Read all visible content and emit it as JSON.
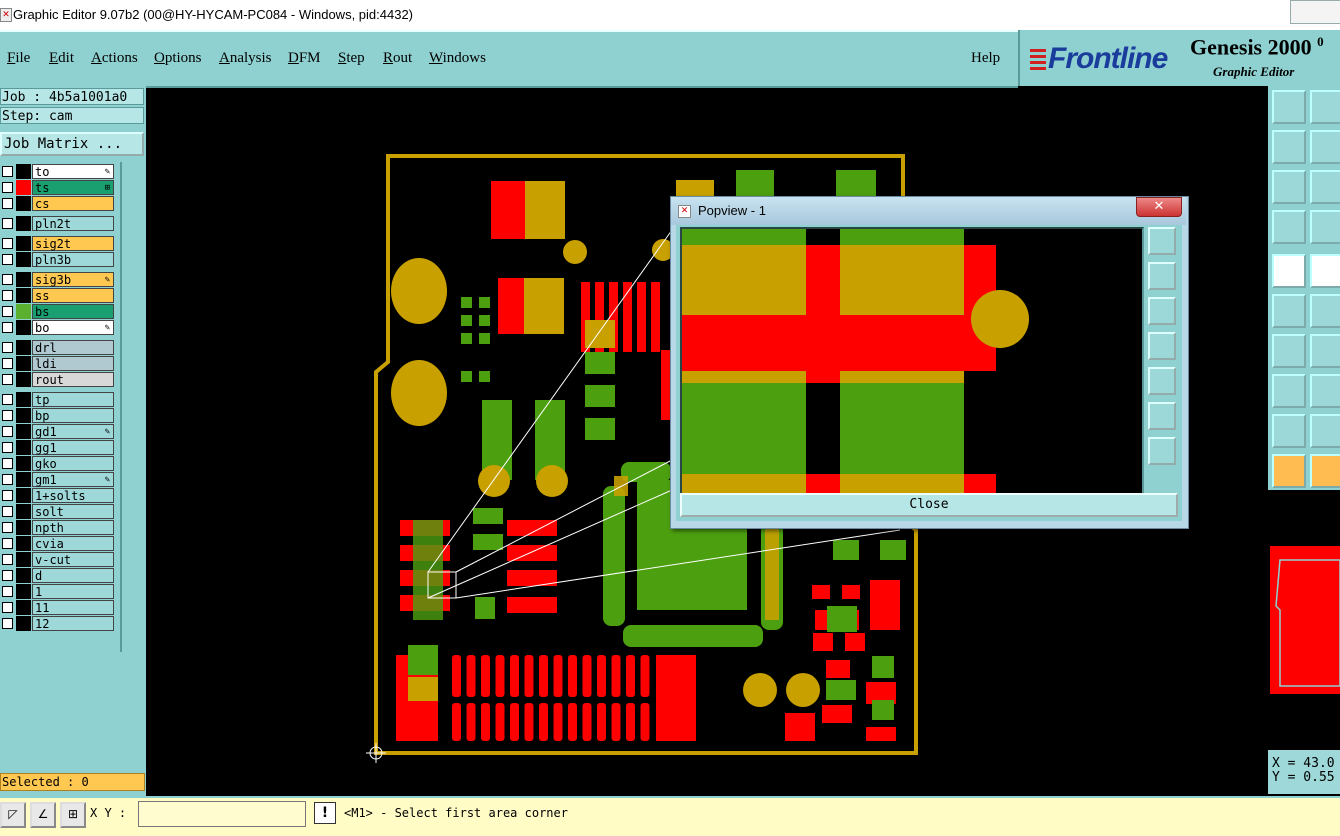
{
  "window": {
    "title": "Graphic Editor 9.07b2 (00@HY-HYCAM-PC084 - Windows, pid:4432)"
  },
  "menu": {
    "file": "File",
    "edit": "Edit",
    "actions": "Actions",
    "options": "Options",
    "analysis": "Analysis",
    "dfm": "DFM",
    "step": "Step",
    "rout": "Rout",
    "windows": "Windows",
    "help": "Help"
  },
  "brand": {
    "logo": "Frontline",
    "product": "Genesis 2000",
    "version_frag": "0",
    "subtitle": "Graphic Editor"
  },
  "job": {
    "job_line": "Job : 4b5a1001a0",
    "step_line": "Step: cam",
    "matrix_button": "Job Matrix ..."
  },
  "layers": [
    {
      "name": "to",
      "bg": "#ffffff",
      "swatch": "#000000",
      "mark": "brush"
    },
    {
      "name": "ts",
      "bg": "#1aa070",
      "swatch": "#ff0000",
      "mark": "grid"
    },
    {
      "name": "cs",
      "bg": "#ffc850",
      "swatch": "#000000",
      "mark": ""
    },
    {
      "name": "pln2t",
      "bg": "#9ed8d8",
      "swatch": "#000000",
      "mark": ""
    },
    {
      "name": "sig2t",
      "bg": "#ffc850",
      "swatch": "#000000",
      "mark": ""
    },
    {
      "name": "pln3b",
      "bg": "#9ed8d8",
      "swatch": "#000000",
      "mark": ""
    },
    {
      "name": "sig3b",
      "bg": "#ffc850",
      "swatch": "#000000",
      "mark": "brush"
    },
    {
      "name": "ss",
      "bg": "#ffc850",
      "swatch": "#000000",
      "mark": ""
    },
    {
      "name": "bs",
      "bg": "#1aa070",
      "swatch": "#5cb030",
      "mark": ""
    },
    {
      "name": "bo",
      "bg": "#ffffff",
      "swatch": "#000000",
      "mark": "brush"
    },
    {
      "name": "drl",
      "bg": "#b0c8d0",
      "swatch": "#000000",
      "mark": ""
    },
    {
      "name": "ldi",
      "bg": "#b0c8d0",
      "swatch": "#000000",
      "mark": ""
    },
    {
      "name": "rout",
      "bg": "#d8d8d8",
      "swatch": "#000000",
      "mark": ""
    },
    {
      "name": "tp",
      "bg": "#9ed8d8",
      "swatch": "#000000",
      "mark": ""
    },
    {
      "name": "bp",
      "bg": "#9ed8d8",
      "swatch": "#000000",
      "mark": ""
    },
    {
      "name": "gd1",
      "bg": "#9ed8d8",
      "swatch": "#000000",
      "mark": "brush"
    },
    {
      "name": "gg1",
      "bg": "#9ed8d8",
      "swatch": "#000000",
      "mark": ""
    },
    {
      "name": "gko",
      "bg": "#9ed8d8",
      "swatch": "#000000",
      "mark": ""
    },
    {
      "name": "gm1",
      "bg": "#9ed8d8",
      "swatch": "#000000",
      "mark": "brush"
    },
    {
      "name": "1+solts",
      "bg": "#9ed8d8",
      "swatch": "#000000",
      "mark": ""
    },
    {
      "name": "solt",
      "bg": "#9ed8d8",
      "swatch": "#000000",
      "mark": ""
    },
    {
      "name": "npth",
      "bg": "#9ed8d8",
      "swatch": "#000000",
      "mark": ""
    },
    {
      "name": "cvia",
      "bg": "#9ed8d8",
      "swatch": "#000000",
      "mark": ""
    },
    {
      "name": "v-cut",
      "bg": "#9ed8d8",
      "swatch": "#000000",
      "mark": ""
    },
    {
      "name": "d",
      "bg": "#9ed8d8",
      "swatch": "#000000",
      "mark": ""
    },
    {
      "name": "1",
      "bg": "#9ed8d8",
      "swatch": "#000000",
      "mark": ""
    },
    {
      "name": "11",
      "bg": "#9ed8d8",
      "swatch": "#000000",
      "mark": ""
    },
    {
      "name": "12",
      "bg": "#9ed8d8",
      "swatch": "#000000",
      "mark": ""
    }
  ],
  "status": {
    "selected": "Selected : 0",
    "xy_label": "X Y :",
    "xy_value": "",
    "alert": "!",
    "prompt": "<M1> - Select first area corner"
  },
  "coords": {
    "x": "X = 43.0",
    "y": "Y = 0.55"
  },
  "popview": {
    "title": "Popview - 1",
    "close_label": "Close",
    "close_x": "✕"
  },
  "colors": {
    "red": "#ff0000",
    "gold": "#c8a000",
    "green": "#4ca010",
    "outline": "#c8a000",
    "panel": "#8fd1d1"
  }
}
